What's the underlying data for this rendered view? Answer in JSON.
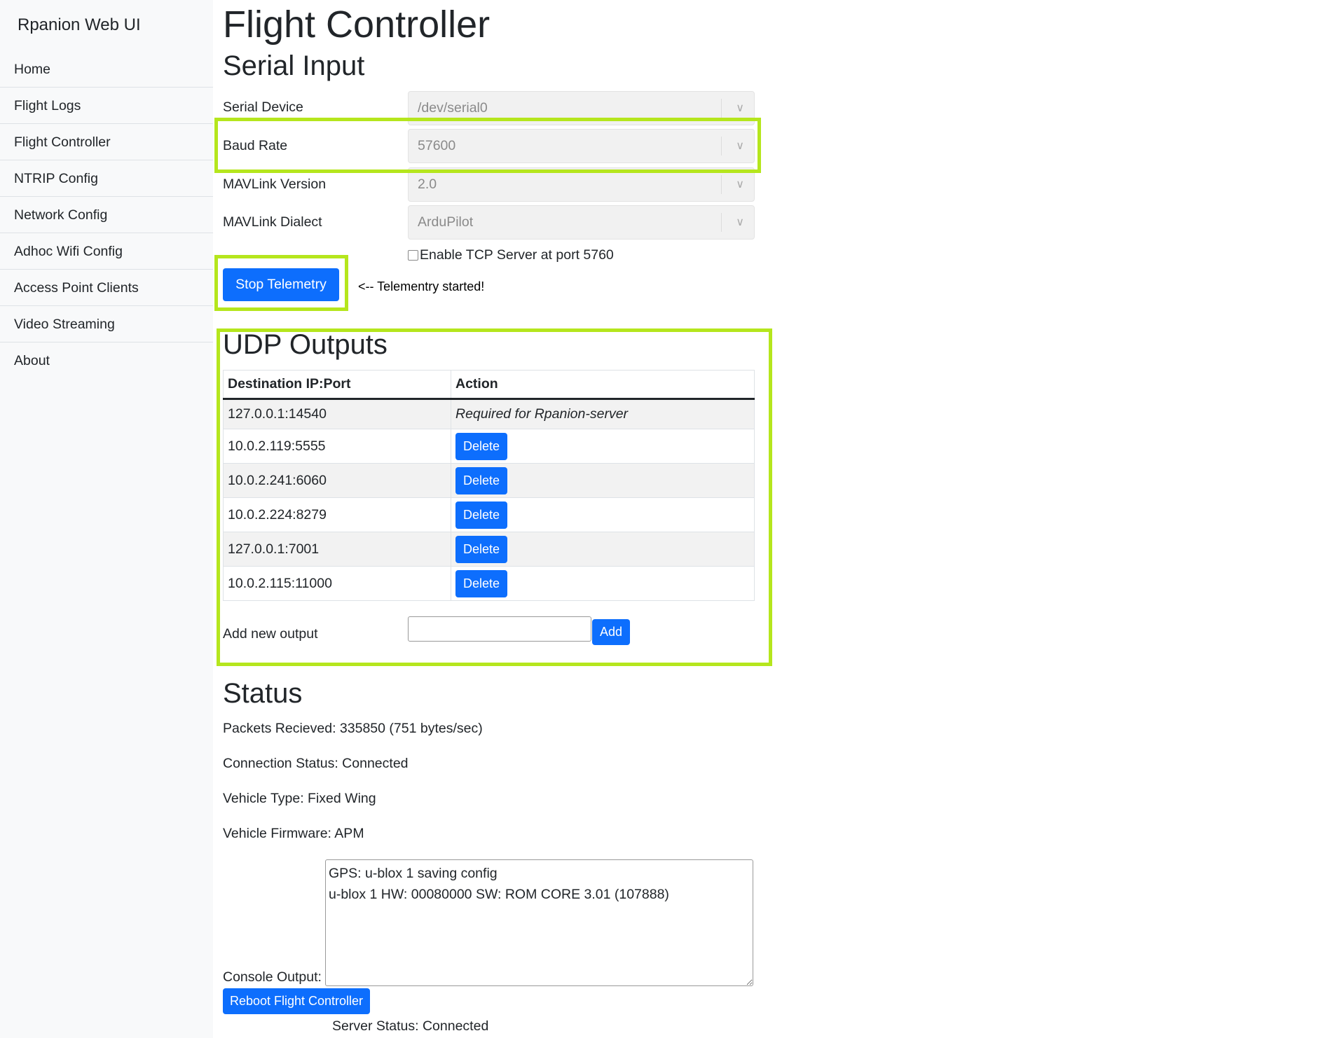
{
  "sidebar": {
    "brand": "Rpanion Web UI",
    "items": [
      {
        "label": "Home"
      },
      {
        "label": "Flight Logs"
      },
      {
        "label": "Flight Controller"
      },
      {
        "label": "NTRIP Config"
      },
      {
        "label": "Network Config"
      },
      {
        "label": "Adhoc Wifi Config"
      },
      {
        "label": "Access Point Clients"
      },
      {
        "label": "Video Streaming"
      },
      {
        "label": "About"
      }
    ]
  },
  "page": {
    "title": "Flight Controller"
  },
  "serial": {
    "heading": "Serial Input",
    "device_label": "Serial Device",
    "device_value": "/dev/serial0",
    "baud_label": "Baud Rate",
    "baud_value": "57600",
    "mavver_label": "MAVLink Version",
    "mavver_value": "2.0",
    "dialect_label": "MAVLink Dialect",
    "dialect_value": "ArduPilot",
    "tcp_label": "Enable TCP Server at port 5760",
    "stop_button": "Stop Telemetry",
    "telemetry_msg": "<-- Telementry started!"
  },
  "udp": {
    "heading": "UDP Outputs",
    "col_dest": "Destination IP:Port",
    "col_action": "Action",
    "rows": [
      {
        "dest": "127.0.0.1:14540",
        "action": "Required for Rpanion-server"
      },
      {
        "dest": "10.0.2.119:5555",
        "action": "Delete"
      },
      {
        "dest": "10.0.2.241:6060",
        "action": "Delete"
      },
      {
        "dest": "10.0.2.224:8279",
        "action": "Delete"
      },
      {
        "dest": "127.0.0.1:7001",
        "action": "Delete"
      },
      {
        "dest": "10.0.2.115:11000",
        "action": "Delete"
      }
    ],
    "add_label": "Add new output",
    "add_value": "",
    "add_button": "Add"
  },
  "status": {
    "heading": "Status",
    "packets": "Packets Recieved: 335850 (751 bytes/sec)",
    "connection": "Connection Status: Connected",
    "vehicle_type": "Vehicle Type: Fixed Wing",
    "firmware": "Vehicle Firmware: APM",
    "console_label": "Console Output:",
    "console_text": "GPS: u-blox 1 saving config\nu-blox 1 HW: 00080000 SW: ROM CORE 3.01 (107888)",
    "reboot_button": "Reboot Flight Controller",
    "server_status": "Server Status: Connected"
  },
  "colors": {
    "accent": "#0d6efd",
    "highlight": "#b5e61d"
  }
}
